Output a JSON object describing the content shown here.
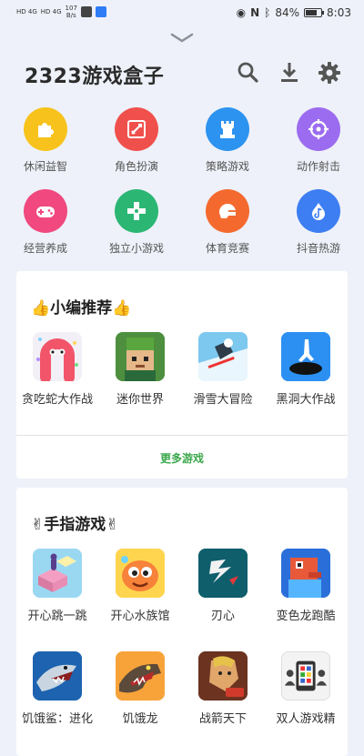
{
  "status_bar": {
    "sim1": "HD 4G",
    "sim2": "HD 4G",
    "net_speed_value": "107",
    "net_speed_unit": "B/s",
    "battery_percent": "84%",
    "battery_level": 0.84,
    "time": "8:03"
  },
  "header": {
    "title": "2323游戏盒子",
    "icons": [
      "search-icon",
      "download-icon",
      "settings-icon"
    ]
  },
  "categories": [
    {
      "label": "休闲益智",
      "icon": "puzzle-icon",
      "color": "#f7c21b"
    },
    {
      "label": "角色扮演",
      "icon": "sword-icon",
      "color": "#f0504c"
    },
    {
      "label": "策略游戏",
      "icon": "castle-icon",
      "color": "#2d93f0"
    },
    {
      "label": "动作射击",
      "icon": "crosshair-icon",
      "color": "#9b6cf0"
    },
    {
      "label": "经营养成",
      "icon": "gamepad-icon",
      "color": "#f0487f"
    },
    {
      "label": "独立小游戏",
      "icon": "dpad-icon",
      "color": "#2bb673"
    },
    {
      "label": "体育竞赛",
      "icon": "helmet-icon",
      "color": "#f46a2e"
    },
    {
      "label": "抖音热游",
      "icon": "music-note-icon",
      "color": "#3d7ef2"
    }
  ],
  "editor_picks": {
    "title": "👍小编推荐👍",
    "games": [
      {
        "name": "贪吃蛇大作战",
        "icon": "snake-game-icon"
      },
      {
        "name": "迷你世界",
        "icon": "mini-world-icon"
      },
      {
        "name": "滑雪大冒险",
        "icon": "ski-icon"
      },
      {
        "name": "黑洞大作战",
        "icon": "black-hole-icon"
      }
    ],
    "more_label": "更多游戏"
  },
  "finger_games": {
    "title": "✌手指游戏✌",
    "games": [
      {
        "name": "开心跳一跳",
        "icon": "jump-game-icon"
      },
      {
        "name": "开心水族馆",
        "icon": "aquarium-icon"
      },
      {
        "name": "刃心",
        "icon": "blade-heart-icon"
      },
      {
        "name": "变色龙跑酷",
        "icon": "chameleon-icon"
      },
      {
        "name": "饥饿鲨：进化",
        "icon": "shark-icon"
      },
      {
        "name": "饥饿龙",
        "icon": "dragon-icon"
      },
      {
        "name": "战箭天下",
        "icon": "archer-icon"
      },
      {
        "name": "双人游戏精",
        "icon": "two-player-icon"
      }
    ]
  }
}
